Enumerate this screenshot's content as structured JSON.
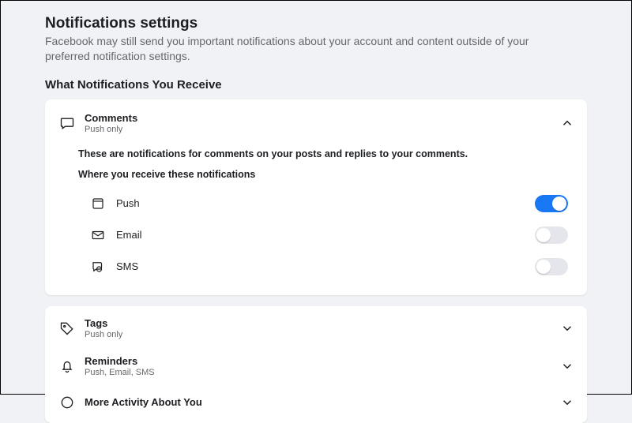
{
  "header": {
    "title": "Notifications settings",
    "description": "Facebook may still send you important notifications about your account and content outside of your preferred notification settings."
  },
  "section_title": "What Notifications You Receive",
  "comments_card": {
    "title": "Comments",
    "subtitle": "Push only",
    "description": "These are notifications for comments on your posts and replies to your comments.",
    "where_label": "Where you receive these notifications",
    "channels": {
      "push": {
        "label": "Push",
        "on": true
      },
      "email": {
        "label": "Email",
        "on": false
      },
      "sms": {
        "label": "SMS",
        "on": false
      }
    }
  },
  "other_rows": {
    "tags": {
      "title": "Tags",
      "subtitle": "Push only"
    },
    "reminders": {
      "title": "Reminders",
      "subtitle": "Push, Email, SMS"
    },
    "more_activity": {
      "title": "More Activity About You"
    }
  }
}
